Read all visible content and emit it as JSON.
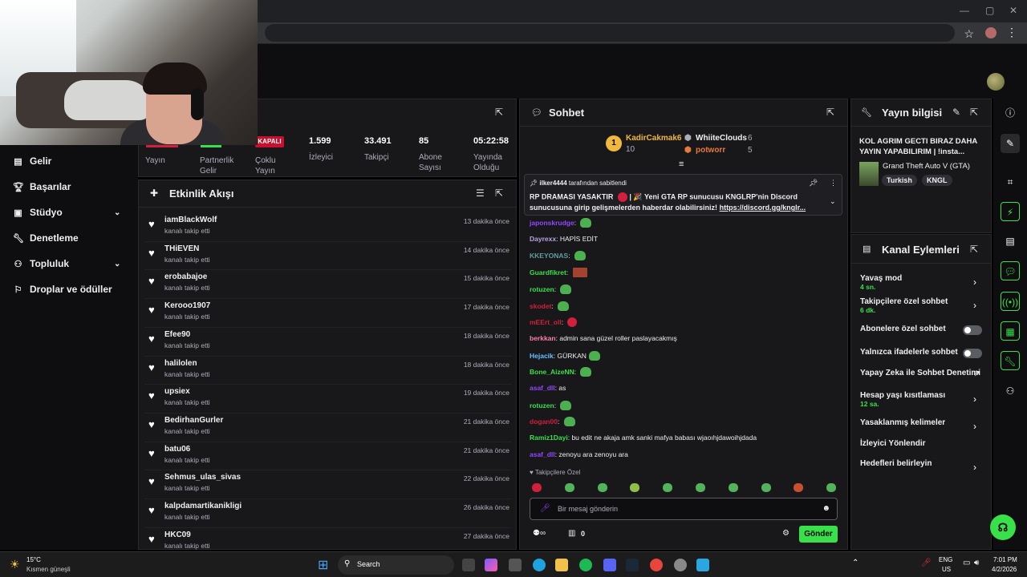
{
  "sidebar": {
    "items": [
      {
        "label": "Gelir",
        "icon": "dollar-icon"
      },
      {
        "label": "Başarılar",
        "icon": "trophy-icon"
      },
      {
        "label": "Stüdyo",
        "icon": "studio-icon"
      },
      {
        "label": "Denetleme",
        "icon": "wrench-icon"
      },
      {
        "label": "Topluluk",
        "icon": "community-icon"
      },
      {
        "label": "Droplar ve ödüller",
        "icon": "drops-icon"
      }
    ]
  },
  "stats": {
    "items": [
      {
        "value": "",
        "label": "Yayın"
      },
      {
        "value": "",
        "label": "Partnerlik Gelir"
      },
      {
        "value": "",
        "label": "Çoklu Yayın",
        "badge": "KAPALI"
      },
      {
        "value": "1.599",
        "label": "İzleyici"
      },
      {
        "value": "33.491",
        "label": "Takipçi"
      },
      {
        "value": "85",
        "label": "Abone Sayısı"
      },
      {
        "value": "05:22:58",
        "label": "Yayında Olduğu Sü"
      }
    ]
  },
  "activity": {
    "title": "Etkinlik Akışı",
    "items": [
      {
        "name": "iamBlackWolf",
        "action": "kanalı takip etti",
        "time": "13 dakika önce"
      },
      {
        "name": "THiEVEN",
        "action": "kanalı takip etti",
        "time": "14 dakika önce"
      },
      {
        "name": "erobabajoe",
        "action": "kanalı takip etti",
        "time": "15 dakika önce"
      },
      {
        "name": "Kerooo1907",
        "action": "kanalı takip etti",
        "time": "17 dakika önce"
      },
      {
        "name": "Efee90",
        "action": "kanalı takip etti",
        "time": "18 dakika önce"
      },
      {
        "name": "halilolen",
        "action": "kanalı takip etti",
        "time": "18 dakika önce"
      },
      {
        "name": "upsiex",
        "action": "kanalı takip etti",
        "time": "19 dakika önce"
      },
      {
        "name": "BedirhanGurler",
        "action": "kanalı takip etti",
        "time": "21 dakika önce"
      },
      {
        "name": "batu06",
        "action": "kanalı takip etti",
        "time": "21 dakika önce"
      },
      {
        "name": "Sehmus_ulas_sivas",
        "action": "kanalı takip etti",
        "time": "22 dakika önce"
      },
      {
        "name": "kalpdamartikanikligi",
        "action": "kanalı takip etti",
        "time": "26 dakika önce"
      },
      {
        "name": "HKC09",
        "action": "kanalı takip etti",
        "time": "27 dakika önce"
      }
    ]
  },
  "chat": {
    "title": "Sohbet",
    "leaders": [
      {
        "name": "KadirCakmak6",
        "count": "10",
        "rank": "1"
      },
      {
        "name": "WhiiteClouds",
        "count": "6"
      },
      {
        "name": "potworr",
        "count": "5"
      }
    ],
    "pinned": {
      "by_user": "ilker4444",
      "by_suffix": "tarafından sabitlendi",
      "line1_a": "RP DRAMASI YASAKTIR",
      "line1_b": "| 🎉 Yeni GTA RP sunucusu KNGLRP'nin Discord",
      "line2": "sunucusuna girip gelişmelerden haberdar olabilirsiniz!",
      "link": "https://discord.gg/knglr..."
    },
    "messages": [
      {
        "user": "japonskrudge",
        "color": "#9147ff",
        "text": "",
        "emote": "green"
      },
      {
        "user": "Dayrexx",
        "color": "#b9a3e3",
        "text": "HAPİS EDİT",
        "emote": ""
      },
      {
        "user": "KKEYONAS",
        "color": "#5f9ea0",
        "text": "",
        "emote": "green"
      },
      {
        "user": "Guardfikret",
        "color": "#38e04a",
        "text": "",
        "emote": "img"
      },
      {
        "user": "rotuzen",
        "color": "#38e04a",
        "text": "",
        "emote": "green"
      },
      {
        "user": "skodet",
        "color": "#d21f3c",
        "text": "",
        "emote": "green"
      },
      {
        "user": "mEErt_oll",
        "color": "#d21f3c",
        "text": "",
        "emote": "red"
      },
      {
        "user": "berkkan",
        "color": "#ff7fab",
        "text": "admin sana güzel roller paslayacakmış",
        "emote": ""
      },
      {
        "user": "Hejacik",
        "color": "#6ac1ff",
        "text": "GÜRKAN",
        "emote": "green"
      },
      {
        "user": "Bone_AizeNN",
        "color": "#38e04a",
        "text": "",
        "emote": "green"
      },
      {
        "user": "asaf_dll",
        "color": "#9147ff",
        "text": "as",
        "emote": ""
      },
      {
        "user": "rotuzen",
        "color": "#38e04a",
        "text": "",
        "emote": "green"
      },
      {
        "user": "dogan00",
        "color": "#d21f3c",
        "text": "",
        "emote": "green"
      },
      {
        "user": "Ramiz1Dayi",
        "color": "#38e04a",
        "text": "bu edit ne akaja amk sanki mafya babası wjaoıhjdawoihjdada",
        "emote": ""
      },
      {
        "user": "asaf_dll",
        "color": "#9147ff",
        "text": "zenoyu ara zenoyu ara",
        "emote": ""
      }
    ],
    "followers_only": "Takipçilere Özel",
    "input_placeholder": "Bir mesaj gönderin",
    "bits": "0",
    "send_label": "Gönder"
  },
  "stream_info": {
    "title": "Yayın bilgisi",
    "stream_title": "KOL AGRIM GECTI BIRAZ DAHA YAYIN YAPABILIRIM | !insta...",
    "category": "Grand Theft Auto V (GTA)",
    "tags": [
      "Turkish",
      "KNGL"
    ]
  },
  "channel_actions": {
    "title": "Kanal Eylemleri",
    "items": [
      {
        "label": "Yavaş mod",
        "sub": "4 sn.",
        "control": "chevron"
      },
      {
        "label": "Takipçilere özel sohbet",
        "sub": "6 dk.",
        "control": "chevron"
      },
      {
        "label": "Abonelere özel sohbet",
        "sub": "",
        "control": "toggle"
      },
      {
        "label": "Yalnızca ifadelerle sohbet",
        "sub": "",
        "control": "toggle"
      },
      {
        "label": "Yapay Zeka ile Sohbet Denetimi",
        "sub": "",
        "control": "external"
      },
      {
        "label": "Hesap yaşı kısıtlaması",
        "sub": "12 sa.",
        "control": "chevron"
      },
      {
        "label": "Yasaklanmış kelimeler",
        "sub": "",
        "control": "chevron"
      },
      {
        "label": "İzleyici Yönlendir",
        "sub": "",
        "control": "none"
      },
      {
        "label": "Hedefleri belirleyin",
        "sub": "",
        "control": "chevron"
      }
    ]
  },
  "taskbar": {
    "weather_temp": "15°C",
    "weather_desc": "Kısmen güneşli",
    "search_label": "Search",
    "lang": "ENG",
    "region": "US",
    "time": "7:01 PM",
    "date": "4/2/2026"
  },
  "colors": {
    "accent": "#38e04a",
    "panel": "#18181b",
    "bg": "#0e0e10",
    "red": "#d21f3c"
  }
}
